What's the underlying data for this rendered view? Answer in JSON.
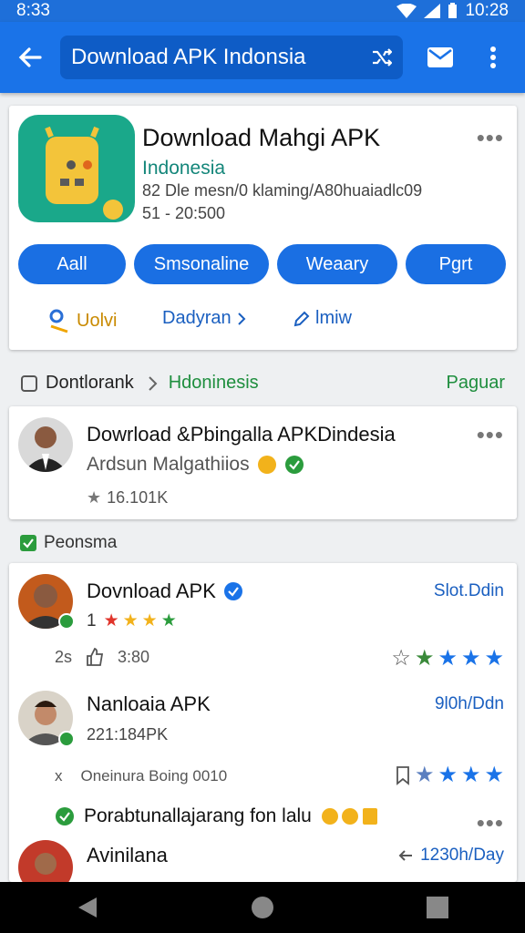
{
  "status": {
    "left": "8:33",
    "time": "10:28"
  },
  "search": {
    "query": "Download APK Indonsia"
  },
  "app_card": {
    "title": "Download Mahgi APK",
    "subtitle": "Indonesia",
    "meta1": "82 Dle mesn/0 klaming/A80huaiadlc09",
    "meta2": "51 - 20:500",
    "pills": [
      "Aall",
      "Smsonaline",
      "Weaary",
      "Pgrt"
    ],
    "links": [
      "Uolvi",
      "Dadyran",
      "lmiw"
    ]
  },
  "breadcrumb": {
    "home": "Dontlorank",
    "current": "Hdoninesis",
    "action": "Paguar"
  },
  "result": {
    "title": "Dowrload &Pbingalla APKDindesia",
    "subtitle": "Ardsun Malgathiios",
    "rating": "16.101K"
  },
  "section_label": "Peonsma",
  "reviews": [
    {
      "name": "Dovnload APK",
      "rating": "1",
      "time": "Slot.Ddin",
      "left_count": "2s",
      "likes": "3:80"
    },
    {
      "name": "Nanloaia APK",
      "sub": "221:184PK",
      "time": "9l0h/Ddn",
      "left_count": "x",
      "note": "Oneinura  Boing 0010"
    }
  ],
  "verified_line": "Porabtunallajarang fon lalu",
  "last_item": {
    "name": "Avinilana",
    "time": "1230h/Day"
  }
}
